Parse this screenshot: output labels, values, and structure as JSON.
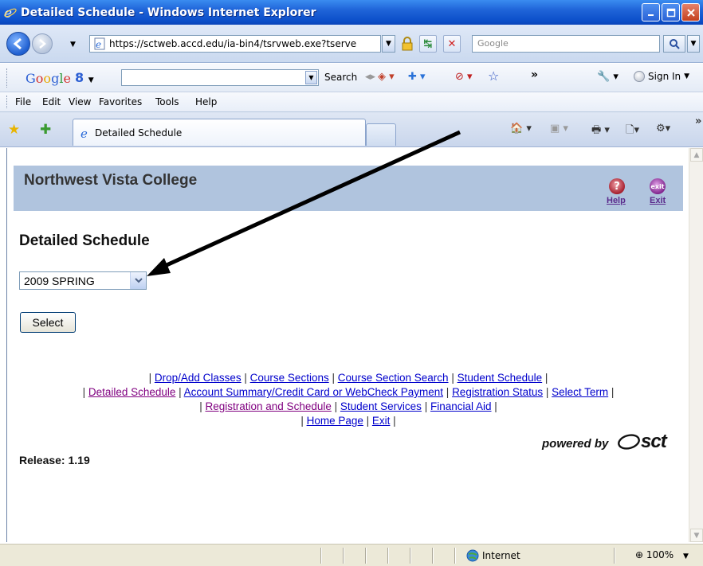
{
  "window": {
    "title": "Detailed Schedule - Windows Internet Explorer"
  },
  "address_bar": {
    "url": "https://sctweb.accd.edu/ia-bin4/tsrvweb.exe?tserve",
    "search_placeholder": "Google"
  },
  "google_toolbar": {
    "logo": "Google",
    "search_label": "Search",
    "sign_in": "Sign In"
  },
  "menu": {
    "items": [
      "File",
      "Edit",
      "View",
      "Favorites",
      "Tools",
      "Help"
    ]
  },
  "tabs": {
    "active": "Detailed Schedule"
  },
  "page": {
    "college_name": "Northwest Vista College",
    "help_label": "Help",
    "exit_label": "Exit",
    "heading": "Detailed Schedule",
    "term_select": {
      "selected": "2009 SPRING"
    },
    "select_button": "Select",
    "nav_links": {
      "drop_add": "Drop/Add Classes",
      "course_sections": "Course Sections",
      "course_section_search": "Course Section Search",
      "student_schedule": "Student Schedule",
      "detailed_schedule": "Detailed Schedule",
      "account_summary": "Account Summary/Credit Card or WebCheck Payment",
      "registration_status": "Registration Status",
      "select_term": "Select Term",
      "registration_schedule": "Registration and Schedule",
      "student_services": "Student Services",
      "financial_aid": "Financial Aid",
      "home_page": "Home Page",
      "exit": "Exit"
    },
    "powered_by": "powered by",
    "sct_logo": "sct",
    "release": "Release: 1.19"
  },
  "status_bar": {
    "zone": "Internet",
    "zoom": "100%"
  },
  "colors": {
    "banner": "#b0c4de",
    "link": "#0000cc",
    "visited_link": "#800080",
    "title_bar": "#0b4ec9"
  }
}
